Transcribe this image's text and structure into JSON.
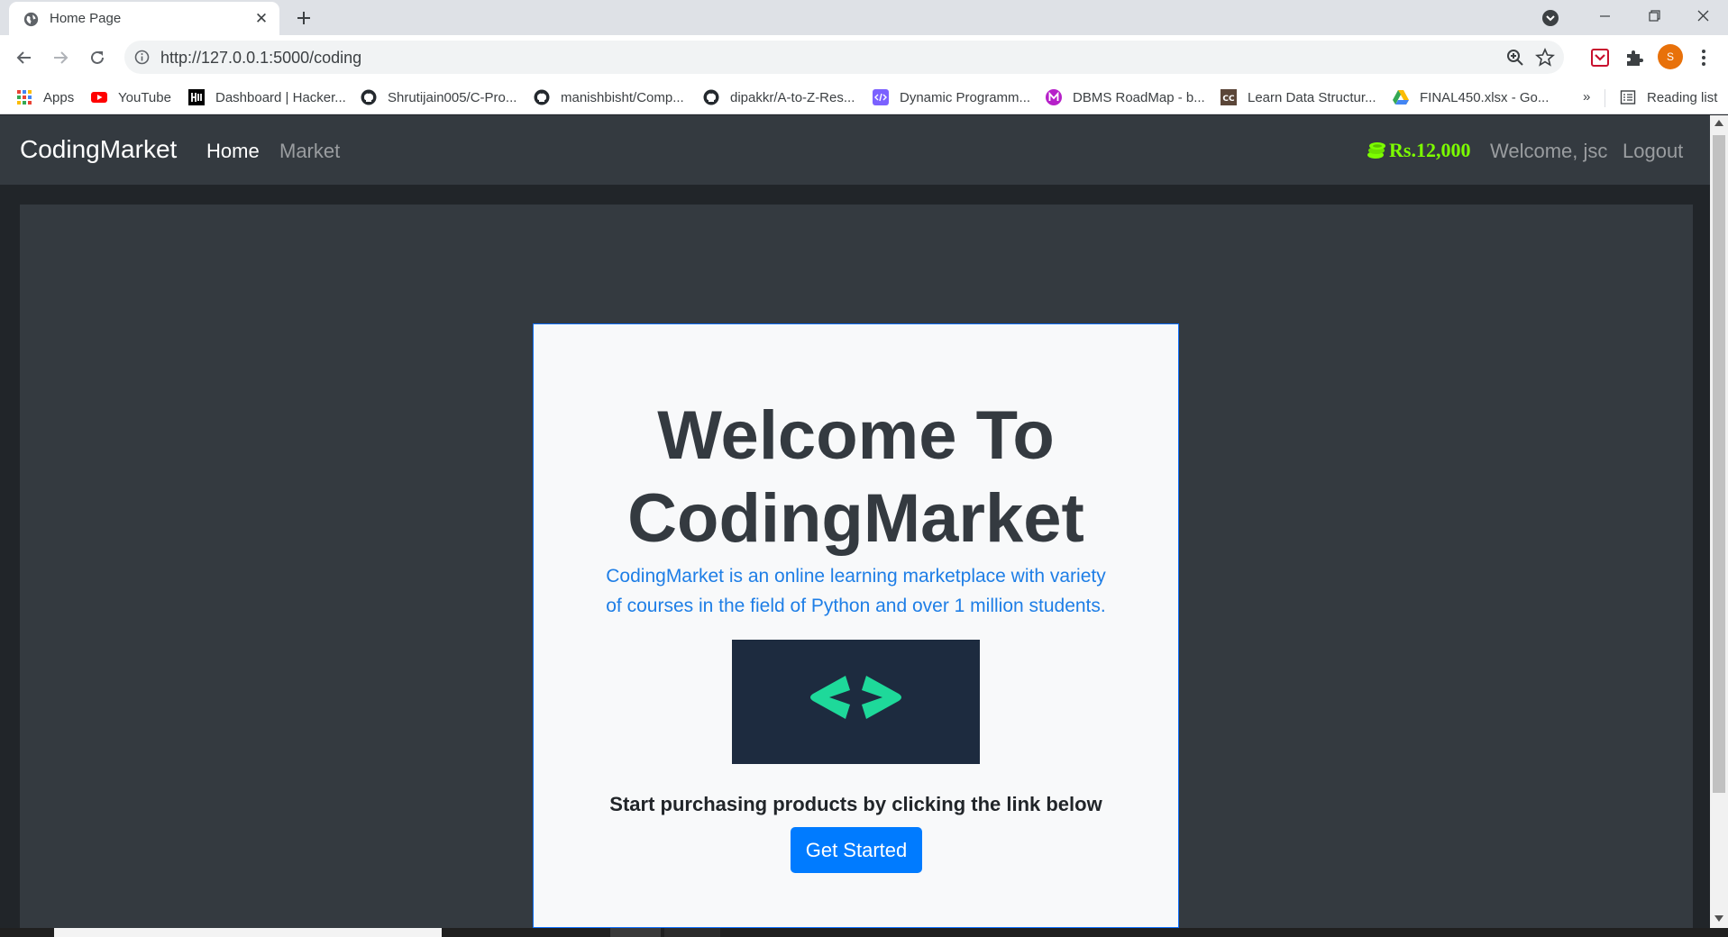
{
  "browser": {
    "tab_title": "Home Page",
    "tab_close": "✕",
    "url": "http://127.0.0.1:5000/coding",
    "profile_initial": "S",
    "bookmarks": [
      {
        "label": "Apps",
        "icon": "apps-grid-icon"
      },
      {
        "label": "YouTube",
        "icon": "youtube-icon"
      },
      {
        "label": "Dashboard | Hacker...",
        "icon": "hackerrank-icon"
      },
      {
        "label": "Shrutijain005/C-Pro...",
        "icon": "github-icon"
      },
      {
        "label": "manishbisht/Comp...",
        "icon": "github-icon"
      },
      {
        "label": "dipakkr/A-to-Z-Res...",
        "icon": "github-icon"
      },
      {
        "label": "Dynamic Programm...",
        "icon": "code-bookmark-icon"
      },
      {
        "label": "DBMS RoadMap - b...",
        "icon": "m-bookmark-icon"
      },
      {
        "label": "Learn Data Structur...",
        "icon": "cc-bookmark-icon"
      },
      {
        "label": "FINAL450.xlsx - Go...",
        "icon": "google-drive-icon"
      }
    ],
    "bookmarks_more": "»",
    "reading_list": "Reading list"
  },
  "site_nav": {
    "brand": "CodingMarket",
    "links": [
      "Home",
      "Market"
    ],
    "budget": "Rs.12,000",
    "welcome": "Welcome, jsc",
    "logout": "Logout"
  },
  "hero": {
    "title_line1": "Welcome To",
    "title_line2": "CodingMarket",
    "lead_line1": "CodingMarket is an online learning marketplace with variety",
    "lead_line2": "of courses in the field of Python and over 1 million students.",
    "cta_text": "Start purchasing products by clicking the link below",
    "button_label": "Get Started"
  },
  "colors": {
    "navbar_bg": "#343a40",
    "budget_green": "#7cfc00",
    "button_blue": "#007bff",
    "lead_blue": "#1e7ee6",
    "logo_bg": "#1d2b3f",
    "logo_accent": "#1ed99a"
  }
}
